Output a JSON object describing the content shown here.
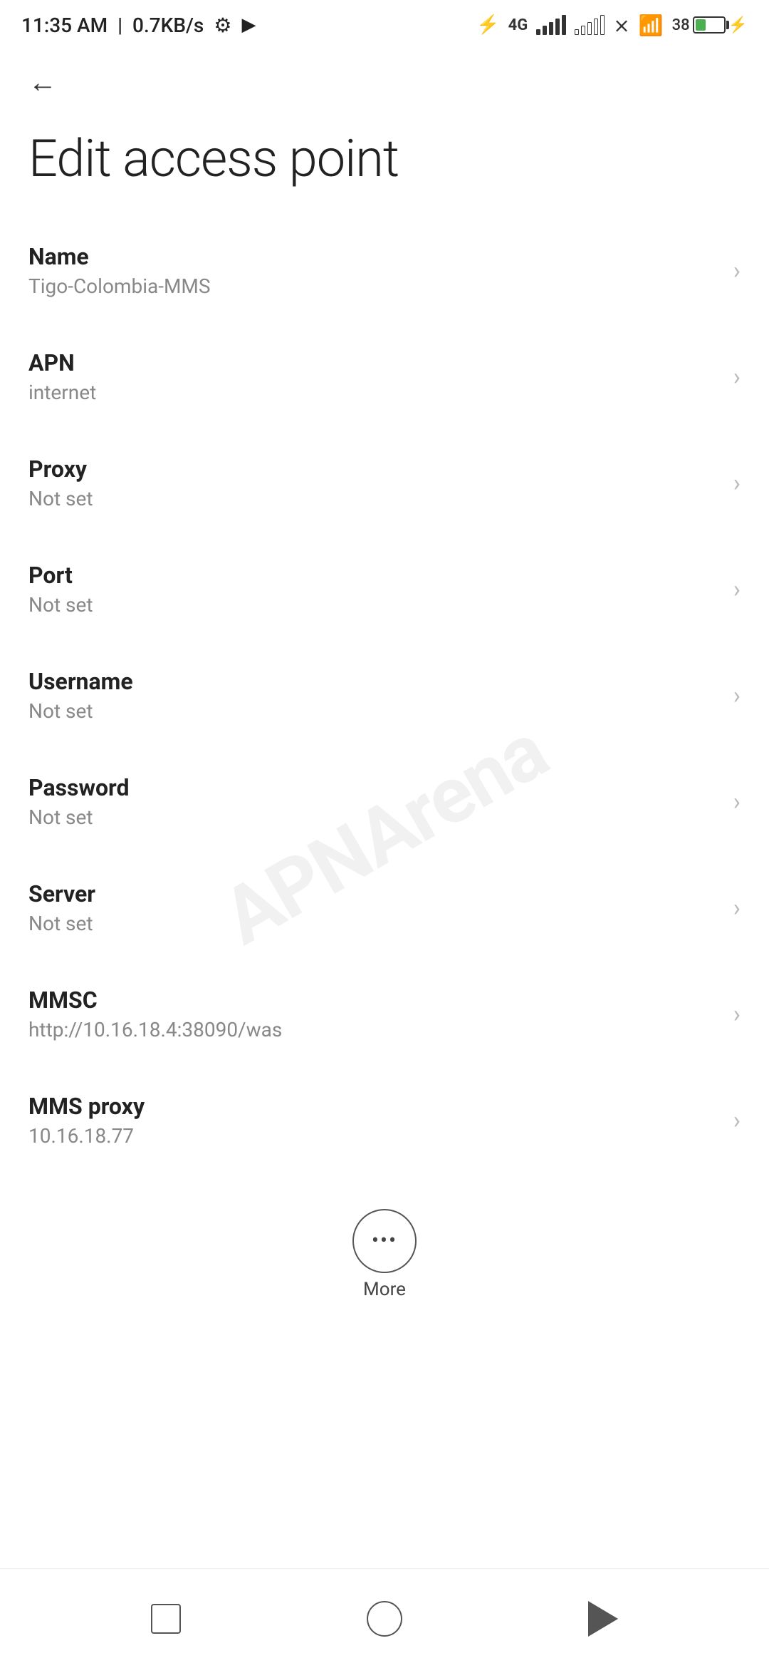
{
  "status_bar": {
    "time": "11:35 AM",
    "speed": "0.7KB/s"
  },
  "page": {
    "title": "Edit access point"
  },
  "settings": {
    "items": [
      {
        "label": "Name",
        "value": "Tigo-Colombia-MMS"
      },
      {
        "label": "APN",
        "value": "internet"
      },
      {
        "label": "Proxy",
        "value": "Not set"
      },
      {
        "label": "Port",
        "value": "Not set"
      },
      {
        "label": "Username",
        "value": "Not set"
      },
      {
        "label": "Password",
        "value": "Not set"
      },
      {
        "label": "Server",
        "value": "Not set"
      },
      {
        "label": "MMSC",
        "value": "http://10.16.18.4:38090/was"
      },
      {
        "label": "MMS proxy",
        "value": "10.16.18.77"
      }
    ]
  },
  "more_button": {
    "label": "More"
  },
  "watermark": {
    "text": "APNArena"
  }
}
